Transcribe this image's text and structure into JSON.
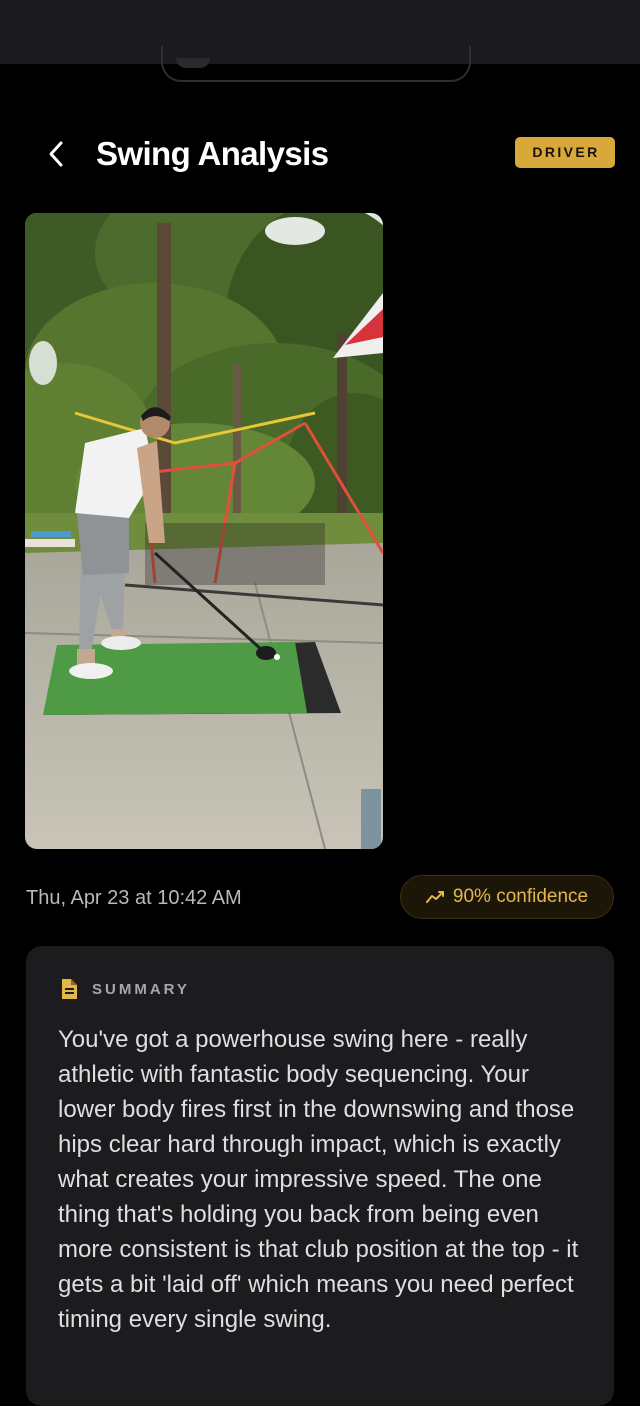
{
  "header": {
    "title": "Swing Analysis",
    "club_badge": "DRIVER"
  },
  "video": {
    "subject": "golfer-address-position"
  },
  "meta": {
    "timestamp": "Thu, Apr 23 at 10:42 AM",
    "confidence_label": "90% confidence",
    "confidence_value": 0.9
  },
  "summary": {
    "label": "SUMMARY",
    "text": "You've got a powerhouse swing here - really athletic with fantastic body sequencing. Your lower body fires first in the downswing and those hips clear hard through impact, which is exactly what creates your impressive speed. The one thing that's holding you back from being even more consistent is that club position at the top - it gets a bit 'laid off' which means you need perfect timing every single swing."
  },
  "icons": {
    "back": "chevron-left-icon",
    "confidence": "trend-up-icon",
    "summary": "document-icon"
  },
  "colors": {
    "accent": "#d9a83a",
    "confidence_text": "#e3b84a",
    "card_bg": "#1c1c1e",
    "background": "#000000"
  }
}
